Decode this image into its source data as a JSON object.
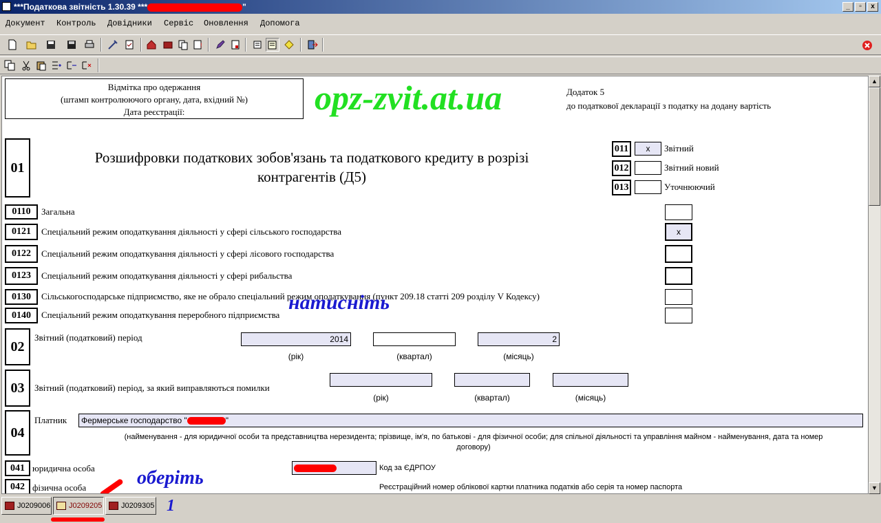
{
  "window": {
    "title": "***Податкова звітність 1.30.39 ***",
    "title_end": "\"",
    "min_btn": "_",
    "max_btn": "▫",
    "close_btn": "x"
  },
  "menu": [
    "Документ",
    "Контроль",
    "Довідники",
    "Сервіс",
    "Оновлення",
    "Допомога"
  ],
  "stamp": {
    "line1": "Відмітка про одержання",
    "line2": "(штамп контролюючого органу, дата, вхідний №)",
    "line3": "Дата реєстрації:"
  },
  "watermark": "opz-zvit.at.ua",
  "addendum": {
    "line1": "Додаток 5",
    "line2": "до податкової декларації з податку на додану вартість"
  },
  "section01": {
    "code": "01",
    "title_line1": "Розшифровки податкових зобов'язань та податкового кредиту в розрізі",
    "title_line2": "контрагентів (Д5)"
  },
  "doc_types": [
    {
      "code": "011",
      "label": "Звітний",
      "mark": "x"
    },
    {
      "code": "012",
      "label": "Звітний новий",
      "mark": ""
    },
    {
      "code": "013",
      "label": "Уточнюючий",
      "mark": ""
    }
  ],
  "regimes": [
    {
      "code": "0110",
      "label": "Загальна",
      "mark": ""
    },
    {
      "code": "0121",
      "label": "Спеціальний режим оподаткування діяльності у сфері сільського господарства",
      "mark": "x"
    },
    {
      "code": "0122",
      "label": "Спеціальний режим оподаткування діяльності у сфері лісового господарства",
      "mark": ""
    },
    {
      "code": "0123",
      "label": "Спеціальний режим оподаткування діяльності у сфері рибальства",
      "mark": ""
    },
    {
      "code": "0130",
      "label": "Сільськогосподарське підприємство, яке не обрало спеціальний режим оподаткування (пункт 209.18 статті 209 розділу V Кодексу)",
      "mark": ""
    },
    {
      "code": "0140",
      "label": "Спеціальний режим оподаткування переробного підприємства",
      "mark": ""
    }
  ],
  "section02": {
    "code": "02",
    "label": "Звітний (податковий) період",
    "year": "2014",
    "quarter": "",
    "month": "2",
    "cap_year": "(рік)",
    "cap_quarter": "(квартал)",
    "cap_month": "(місяць)"
  },
  "section03": {
    "code": "03",
    "label": "Звітний (податковий) період, за який виправляються помилки",
    "year": "",
    "quarter": "",
    "month": "",
    "cap_year": "(рік)",
    "cap_quarter": "(квартал)",
    "cap_month": "(місяць)"
  },
  "section04": {
    "code": "04",
    "label": "Платник",
    "value": "Фермерське господарство \"",
    "value_end": "\"",
    "note_line1": "(найменування - для юридичної особи та представництва нерезидента; прізвище, ім'я, по батькові - для фізичної особи; для спільної діяльності та управління майном - найменування, дата та номер",
    "note_line2": "договору)"
  },
  "section041": {
    "code": "041",
    "label": "юридична особа",
    "edrpou_label": "Код за ЄДРПОУ"
  },
  "section042": {
    "code": "042",
    "label": "фізична особа",
    "note": "Реєстраційний номер облікової картки платника податків або серія та номер паспорта"
  },
  "annotations": {
    "press": "натисніть",
    "choose": "оберіть",
    "num": "1"
  },
  "tabs": [
    {
      "label": "J0209006",
      "active": false
    },
    {
      "label": "J0209205",
      "active": true
    },
    {
      "label": "J0209305",
      "active": false
    }
  ],
  "toolbar1_icons": [
    "new-icon",
    "open-icon",
    "save-icon",
    "save-as-icon",
    "print-icon",
    "tools-icon",
    "check-icon",
    "home-icon",
    "book-icon",
    "copy-doc-icon",
    "export-icon",
    "edit-icon",
    "document-icon",
    "properties-icon",
    "list-icon",
    "help-icon",
    "exit-icon"
  ],
  "toolbar2_icons": [
    "copy-icon",
    "cut-icon",
    "paste-icon",
    "insert-row-icon",
    "add-row-icon",
    "delete-row-icon"
  ]
}
